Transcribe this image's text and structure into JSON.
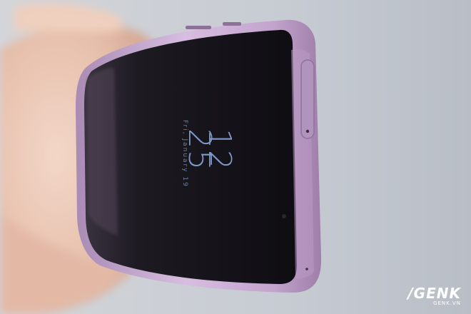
{
  "phone_screen": {
    "clock_hours": "12",
    "clock_minutes": "25",
    "date_text": "Fri, January 19"
  },
  "watermark": {
    "logo": "/GENK",
    "sub": "GENK.VN"
  },
  "colors": {
    "background": "#c9ced4",
    "phone_frame": "#c6a8cf",
    "screen": "#141218",
    "clock_text": "#7e98c8",
    "skin": "#e9c7b4"
  }
}
